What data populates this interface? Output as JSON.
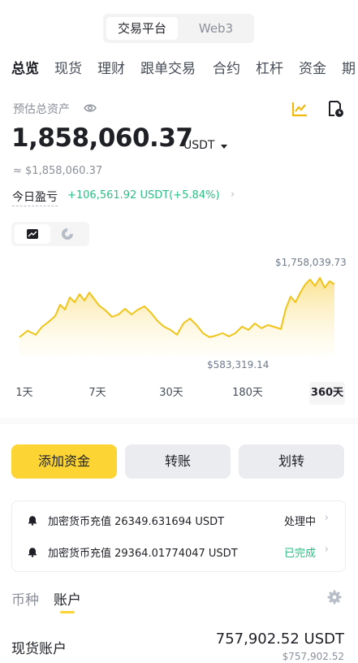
{
  "top_switch": {
    "items": [
      "交易平台",
      "Web3"
    ],
    "active": "交易平台"
  },
  "nav_tabs": [
    "总览",
    "现货",
    "理财",
    "跟单交易",
    "合约",
    "杠杆",
    "资金",
    "期"
  ],
  "nav_active": "总览",
  "overview": {
    "estimated_label": "预估总资产",
    "total_value": "1,858,060.37",
    "unit": "USDT",
    "approx_fiat": "≈ $1,858,060.37",
    "pnl_label": "今日盈亏",
    "pnl_value": "+106,561.92 USDT(+5.84%)",
    "pnl_arrow": "›"
  },
  "chart": {
    "high_label": "$1,758,039.73",
    "low_label": "$583,319.14",
    "line_color": "#f0c419",
    "ranges": [
      "1天",
      "7天",
      "30天",
      "180天",
      "360天"
    ],
    "active_range": "360天"
  },
  "actions": {
    "deposit": "添加资金",
    "transfer": "转账",
    "move": "划转"
  },
  "notices": [
    {
      "text": "加密货币充值 26349.631694 USDT",
      "status": "处理中",
      "status_color": "#1e2026",
      "arrow": "›"
    },
    {
      "text": "加密货币充值 29364.01774047 USDT",
      "status": "已完成",
      "status_color": "#2ebd85",
      "arrow": "›"
    }
  ],
  "sub_tabs": {
    "coin": "币种",
    "account": "账户",
    "active": "账户"
  },
  "accounts": [
    {
      "name": "现货账户",
      "value": "757,902.52 USDT",
      "fiat": "$757,902.52"
    }
  ],
  "icons": {
    "eye": "eye-icon",
    "chart_toggle": "line-chart-icon",
    "history": "history-icon",
    "line_mode": "line-chart-icon",
    "pie_mode": "pie-chart-icon",
    "bell": "bell-icon",
    "gear": "gear-icon"
  },
  "colors": {
    "accent": "#fcd535",
    "positive": "#2ebd85",
    "text_primary": "#1e2026",
    "text_muted": "#8a8f99"
  }
}
